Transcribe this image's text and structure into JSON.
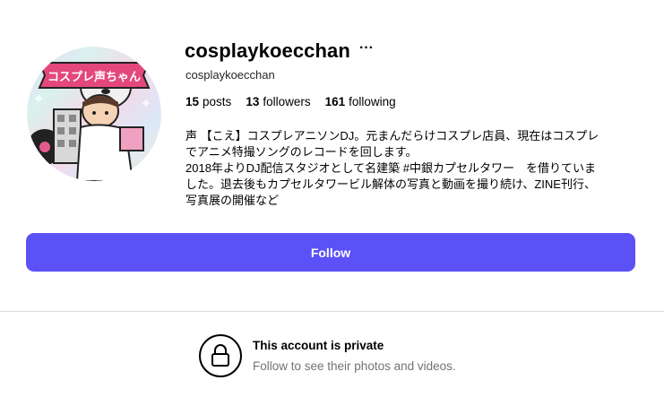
{
  "profile": {
    "username": "cosplaykoecchan",
    "more_icon": "···",
    "handle": "cosplaykoecchan",
    "avatar_text": "コスプレ声ちゃん",
    "stats": [
      {
        "count": "15",
        "label": "posts"
      },
      {
        "count": "13",
        "label": "followers"
      },
      {
        "count": "161",
        "label": "following"
      }
    ],
    "bio_lines": [
      "声 【こえ】コスプレアニソンDJ。元まんだらけコスプレ店員、現在はコスプレ",
      "でアニメ特撮ソングのレコードを回します。",
      "2018年よりDJ配信スタジオとして名建築 #中銀カプセルタワー　を借りていま",
      "した。退去後もカプセルタワービル解体の写真と動画を撮り続け、ZINE刊行、",
      "写真展の開催など"
    ]
  },
  "actions": {
    "follow_label": "Follow"
  },
  "private": {
    "title": "This account is private",
    "subtitle": "Follow to see their photos and videos."
  },
  "colors": {
    "follow_button": "#5b51f6",
    "secondary_text": "#737373",
    "divider": "#dbdbdb"
  }
}
